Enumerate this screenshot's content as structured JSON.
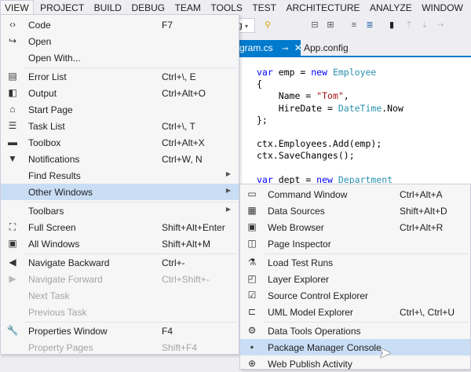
{
  "menubar": [
    "VIEW",
    "PROJECT",
    "BUILD",
    "DEBUG",
    "TEAM",
    "TOOLS",
    "TEST",
    "ARCHITECTURE",
    "ANALYZE",
    "WINDOW"
  ],
  "toolbar": {
    "config_combo": "g"
  },
  "tabs": {
    "active": "gram.cs",
    "other": "App.config"
  },
  "code": [
    [
      {
        "t": "var ",
        "c": "kw"
      },
      {
        "t": "emp = "
      },
      {
        "t": "new ",
        "c": "kw"
      },
      {
        "t": "Employee",
        "c": "ty"
      }
    ],
    [
      {
        "t": "{"
      }
    ],
    [
      {
        "t": "    Name = "
      },
      {
        "t": "\"Tom\"",
        "c": "st"
      },
      {
        "t": ","
      }
    ],
    [
      {
        "t": "    HireDate = "
      },
      {
        "t": "DateTime",
        "c": "ty"
      },
      {
        "t": ".Now"
      }
    ],
    [
      {
        "t": "};"
      }
    ],
    [],
    [
      {
        "t": "ctx.Employees.Add(emp);"
      }
    ],
    [
      {
        "t": "ctx.SaveChanges();"
      }
    ],
    [],
    [
      {
        "t": "var ",
        "c": "kw"
      },
      {
        "t": "dept = "
      },
      {
        "t": "new ",
        "c": "kw"
      },
      {
        "t": "Department",
        "c": "ty"
      }
    ]
  ],
  "view_menu": [
    {
      "label": "Code",
      "shortcut": "F7",
      "icon": "code-icon",
      "glyph": "‹›"
    },
    {
      "label": "Open",
      "icon": "open-icon",
      "glyph": "↪"
    },
    {
      "label": "Open With..."
    },
    {
      "sep": true
    },
    {
      "label": "Error List",
      "shortcut": "Ctrl+\\, E",
      "icon": "error-list-icon",
      "glyph": "▤"
    },
    {
      "label": "Output",
      "shortcut": "Ctrl+Alt+O",
      "icon": "output-icon",
      "glyph": "◧"
    },
    {
      "label": "Start Page",
      "icon": "start-page-icon",
      "glyph": "⌂"
    },
    {
      "label": "Task List",
      "shortcut": "Ctrl+\\, T",
      "icon": "task-list-icon",
      "glyph": "☰"
    },
    {
      "label": "Toolbox",
      "shortcut": "Ctrl+Alt+X",
      "icon": "toolbox-icon",
      "glyph": "▬"
    },
    {
      "label": "Notifications",
      "shortcut": "Ctrl+W, N",
      "icon": "notifications-icon",
      "glyph": "▼"
    },
    {
      "label": "Find Results",
      "submenu": true
    },
    {
      "label": "Other Windows",
      "submenu": true,
      "highlighted": true
    },
    {
      "sep": true
    },
    {
      "label": "Toolbars",
      "submenu": true
    },
    {
      "label": "Full Screen",
      "shortcut": "Shift+Alt+Enter",
      "icon": "full-screen-icon",
      "glyph": "⛶"
    },
    {
      "label": "All Windows",
      "shortcut": "Shift+Alt+M",
      "icon": "all-windows-icon",
      "glyph": "▣"
    },
    {
      "sep": true
    },
    {
      "label": "Navigate Backward",
      "shortcut": "Ctrl+-",
      "icon": "navigate-backward-icon",
      "glyph": "◀"
    },
    {
      "label": "Navigate Forward",
      "shortcut": "Ctrl+Shift+-",
      "icon": "navigate-forward-icon",
      "glyph": "▶",
      "disabled": true
    },
    {
      "label": "Next Task",
      "disabled": true
    },
    {
      "label": "Previous Task",
      "disabled": true
    },
    {
      "sep": true
    },
    {
      "label": "Properties Window",
      "shortcut": "F4",
      "icon": "wrench-icon",
      "glyph": "🔧"
    },
    {
      "label": "Property Pages",
      "shortcut": "Shift+F4",
      "disabled": true
    }
  ],
  "other_windows_menu": [
    {
      "label": "Command Window",
      "shortcut": "Ctrl+Alt+A",
      "icon": "command-window-icon",
      "glyph": "▭"
    },
    {
      "label": "Data Sources",
      "shortcut": "Shift+Alt+D",
      "icon": "data-sources-icon",
      "glyph": "▦"
    },
    {
      "label": "Web Browser",
      "shortcut": "Ctrl+Alt+R",
      "icon": "web-browser-icon",
      "glyph": "▣"
    },
    {
      "label": "Page Inspector",
      "icon": "page-inspector-icon",
      "glyph": "◫"
    },
    {
      "sep": true
    },
    {
      "label": "Load Test Runs",
      "icon": "load-test-icon",
      "glyph": "⚗"
    },
    {
      "label": "Layer Explorer",
      "icon": "layer-explorer-icon",
      "glyph": "◰"
    },
    {
      "label": "Source Control Explorer",
      "icon": "source-control-icon",
      "glyph": "☑"
    },
    {
      "label": "UML Model Explorer",
      "shortcut": "Ctrl+\\, Ctrl+U",
      "icon": "uml-icon",
      "glyph": "⊏"
    },
    {
      "sep": true
    },
    {
      "label": "Data Tools Operations",
      "icon": "data-tools-icon",
      "glyph": "⚙"
    },
    {
      "label": "Package Manager Console",
      "icon": "console-icon",
      "glyph": "▪",
      "highlighted": true
    },
    {
      "label": "Web Publish Activity",
      "icon": "web-publish-icon",
      "glyph": "⊕"
    }
  ],
  "colors": {
    "accent": "#007acc",
    "highlight": "#c9def5"
  }
}
